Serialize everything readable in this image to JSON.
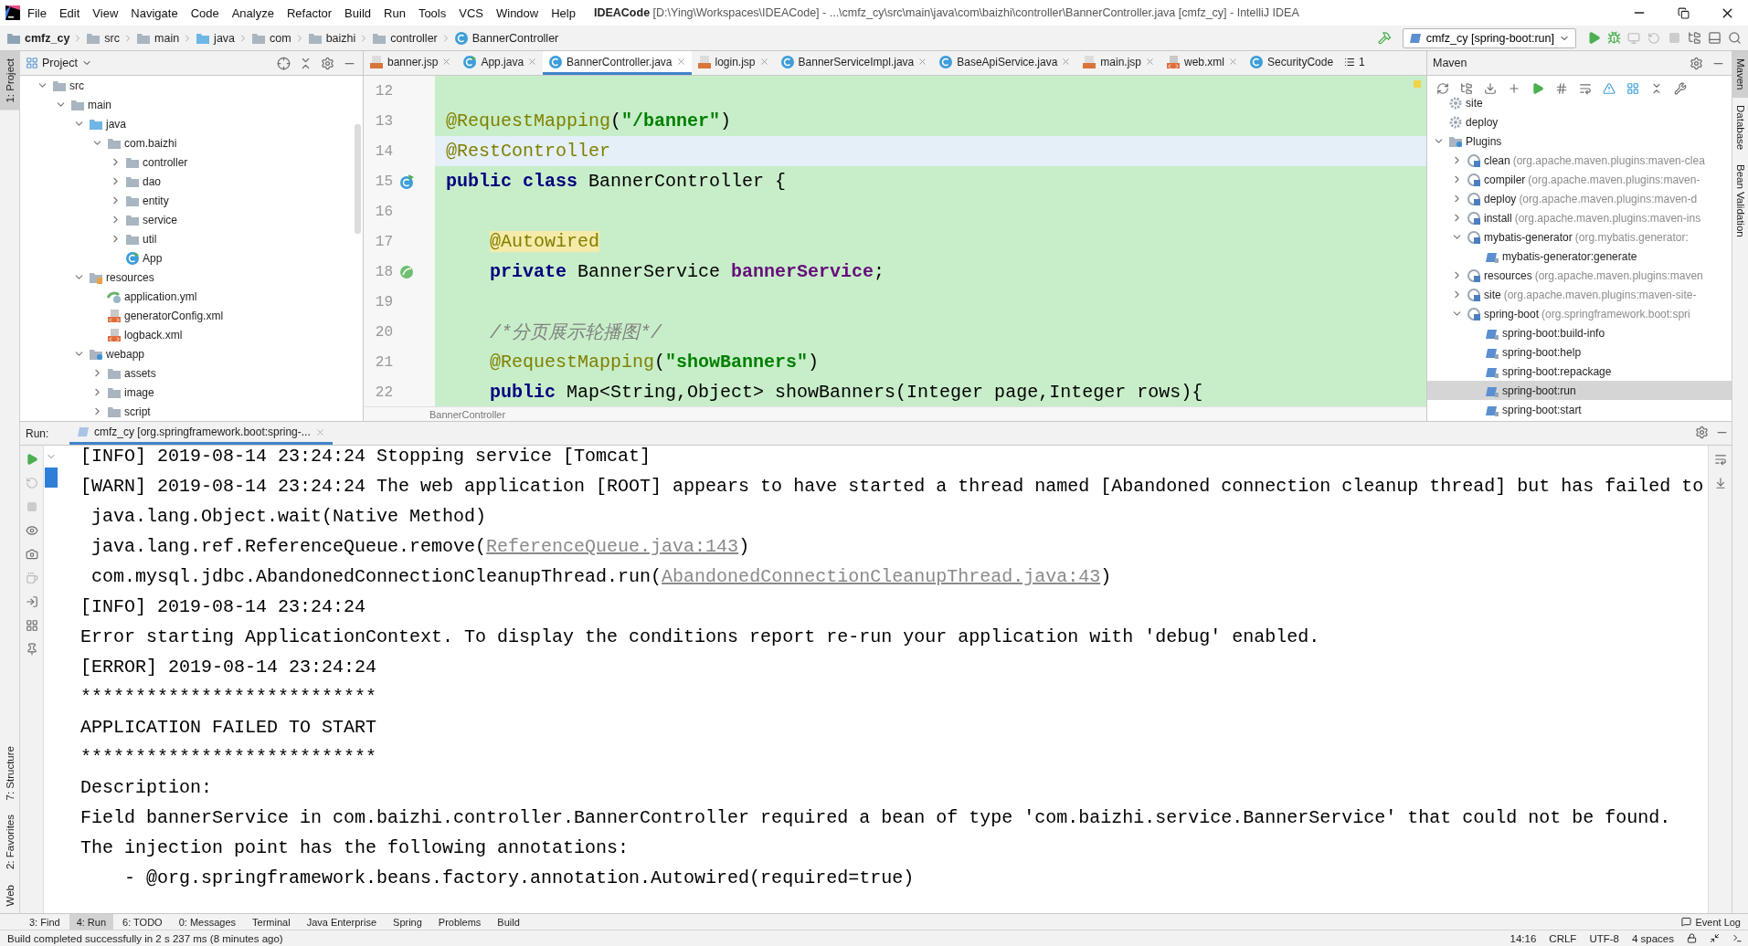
{
  "menu_bar": {
    "items": [
      "File",
      "Edit",
      "View",
      "Navigate",
      "Code",
      "Analyze",
      "Refactor",
      "Build",
      "Run",
      "Tools",
      "VCS",
      "Window",
      "Help"
    ],
    "title": "**IDEACode** [D:\\Ying\\Workspaces\\IDEACode] - ...\\cmfz_cy\\src\\main\\java\\com\\baizhi\\controller\\BannerController.java [cmfz_cy] - IntelliJ IDEA"
  },
  "navigation_bar": {
    "breadcrumbs": [
      {
        "label": "cmfz_cy",
        "kind": "module"
      },
      {
        "label": "src",
        "kind": "folder"
      },
      {
        "label": "main",
        "kind": "folder"
      },
      {
        "label": "java",
        "kind": "source"
      },
      {
        "label": "com",
        "kind": "package"
      },
      {
        "label": "baizhi",
        "kind": "package"
      },
      {
        "label": "controller",
        "kind": "package"
      },
      {
        "label": "BannerController",
        "kind": "class"
      }
    ],
    "run_configuration": "cmfz_cy [spring-boot:run]"
  },
  "left_tool_strip": [
    {
      "label": "1: Project",
      "selected": true
    },
    {
      "label": "7: Structure",
      "selected": false
    },
    {
      "label": "2: Favorites",
      "selected": false
    },
    {
      "label": "Web",
      "selected": false
    }
  ],
  "project_panel": {
    "title": "Project",
    "tree": [
      {
        "label": "src",
        "kind": "folder",
        "expanded": true,
        "children": [
          {
            "label": "main",
            "kind": "folder",
            "expanded": true,
            "children": [
              {
                "label": "java",
                "kind": "source",
                "expanded": true,
                "children": [
                  {
                    "label": "com.baizhi",
                    "kind": "package",
                    "expanded": true,
                    "children": [
                      {
                        "label": "controller",
                        "kind": "package",
                        "expanded": false
                      },
                      {
                        "label": "dao",
                        "kind": "package",
                        "expanded": false
                      },
                      {
                        "label": "entity",
                        "kind": "package",
                        "expanded": false
                      },
                      {
                        "label": "service",
                        "kind": "package",
                        "expanded": false
                      },
                      {
                        "label": "util",
                        "kind": "package",
                        "expanded": false
                      },
                      {
                        "label": "App",
                        "kind": "app"
                      }
                    ]
                  }
                ]
              },
              {
                "label": "resources",
                "kind": "resources",
                "expanded": true,
                "children": [
                  {
                    "label": "application.yml",
                    "kind": "yml"
                  },
                  {
                    "label": "generatorConfig.xml",
                    "kind": "xml"
                  },
                  {
                    "label": "logback.xml",
                    "kind": "xml"
                  }
                ]
              },
              {
                "label": "webapp",
                "kind": "web",
                "expanded": true,
                "children": [
                  {
                    "label": "assets",
                    "kind": "folder",
                    "expanded": false
                  },
                  {
                    "label": "image",
                    "kind": "folder",
                    "expanded": false
                  },
                  {
                    "label": "script",
                    "kind": "folder",
                    "expanded": false
                  }
                ]
              }
            ]
          }
        ]
      }
    ]
  },
  "editor": {
    "tabs": [
      {
        "label": "banner.jsp",
        "kind": "jsp",
        "selected": false,
        "closable": true
      },
      {
        "label": "App.java",
        "kind": "app",
        "selected": false,
        "closable": true
      },
      {
        "label": "BannerController.java",
        "kind": "class",
        "selected": true,
        "closable": true
      },
      {
        "label": "login.jsp",
        "kind": "jsp",
        "selected": false,
        "closable": true
      },
      {
        "label": "BannerServiceImpl.java",
        "kind": "class",
        "selected": false,
        "closable": true
      },
      {
        "label": "BaseApiService.java",
        "kind": "class",
        "selected": false,
        "closable": true
      },
      {
        "label": "main.jsp",
        "kind": "jsp",
        "selected": false,
        "closable": true
      },
      {
        "label": "web.xml",
        "kind": "xml",
        "selected": false,
        "closable": true
      },
      {
        "label": "SecurityCode",
        "kind": "class",
        "selected": false,
        "closable": false
      }
    ],
    "overflow_count": "1",
    "lines": [
      {
        "number": "12",
        "current": false
      },
      {
        "number": "13",
        "current": false,
        "tokens": [
          {
            "text": "@RequestMapping",
            "kind": "annotation"
          },
          {
            "text": "(",
            "kind": "plain"
          },
          {
            "text": "\"/banner\"",
            "kind": "string"
          },
          {
            "text": ")",
            "kind": "plain"
          }
        ]
      },
      {
        "number": "14",
        "current": true,
        "tokens": [
          {
            "text": "@RestController",
            "kind": "annotation"
          }
        ]
      },
      {
        "number": "15",
        "current": false,
        "gutter_icon": {
          "kind": "class"
        },
        "tokens": [
          {
            "text": "public class",
            "kind": "keyword"
          },
          {
            "text": " BannerController {",
            "kind": "plain"
          }
        ]
      },
      {
        "number": "16",
        "current": false
      },
      {
        "number": "17",
        "current": false,
        "tokens": [
          {
            "text": "    @Autowired",
            "kind": "marked"
          }
        ]
      },
      {
        "number": "18",
        "current": false,
        "gutter_icon": {
          "kind": "bean"
        },
        "tokens": [
          {
            "text": "    private",
            "kind": "keyword"
          },
          {
            "text": " BannerService ",
            "kind": "plain"
          },
          {
            "text": "bannerService",
            "kind": "field"
          },
          {
            "text": ";",
            "kind": "plain"
          }
        ]
      },
      {
        "number": "19",
        "current": false
      },
      {
        "number": "20",
        "current": false,
        "tokens": [
          {
            "text": "    /*分页展示轮播图*/",
            "kind": "comment"
          }
        ]
      },
      {
        "number": "21",
        "current": false,
        "tokens": [
          {
            "text": "    @RequestMapping",
            "kind": "annotation"
          },
          {
            "text": "(",
            "kind": "plain"
          },
          {
            "text": "\"showBanners\"",
            "kind": "string"
          },
          {
            "text": ")",
            "kind": "plain"
          }
        ]
      },
      {
        "number": "22",
        "current": false,
        "tokens": [
          {
            "text": "    public",
            "kind": "keyword"
          },
          {
            "text": " Map<String,Object> showBanners(Integer page,Integer rows){",
            "kind": "plain"
          }
        ]
      }
    ],
    "breadcrumb": "BannerController"
  },
  "maven_panel": {
    "title": "Maven",
    "tree": [
      {
        "label": "site",
        "kind": "phase",
        "selected": false
      },
      {
        "label": "deploy",
        "kind": "phase",
        "selected": false
      },
      {
        "label": "Plugins",
        "kind": "plugins",
        "expanded": true,
        "selected": false,
        "children": [
          {
            "label": "clean",
            "detail": "(org.apache.maven.plugins:maven-clea",
            "kind": "plugin",
            "expanded": false,
            "selected": false
          },
          {
            "label": "compiler",
            "detail": "(org.apache.maven.plugins:maven-",
            "kind": "plugin",
            "expanded": false,
            "selected": false
          },
          {
            "label": "deploy",
            "detail": "(org.apache.maven.plugins:maven-d",
            "kind": "plugin",
            "expanded": false,
            "selected": false
          },
          {
            "label": "install",
            "detail": "(org.apache.maven.plugins:maven-ins",
            "kind": "plugin",
            "expanded": false,
            "selected": false
          },
          {
            "label": "mybatis-generator",
            "detail": "(org.mybatis.generator:",
            "kind": "plugin",
            "expanded": true,
            "selected": false,
            "children": [
              {
                "label": "mybatis-generator:generate",
                "kind": "goal",
                "selected": false
              }
            ]
          },
          {
            "label": "resources",
            "detail": "(org.apache.maven.plugins:maven",
            "kind": "plugin",
            "expanded": false,
            "selected": false
          },
          {
            "label": "site",
            "detail": "(org.apache.maven.plugins:maven-site-",
            "kind": "plugin",
            "expanded": false,
            "selected": false
          },
          {
            "label": "spring-boot",
            "detail": "(org.springframework.boot:spri",
            "kind": "plugin",
            "expanded": true,
            "selected": false,
            "children": [
              {
                "label": "spring-boot:build-info",
                "kind": "goal",
                "selected": false
              },
              {
                "label": "spring-boot:help",
                "kind": "goal",
                "selected": false
              },
              {
                "label": "spring-boot:repackage",
                "kind": "goal",
                "selected": false
              },
              {
                "label": "spring-boot:run",
                "kind": "goal",
                "selected": true
              },
              {
                "label": "spring-boot:start",
                "kind": "goal",
                "selected": false
              }
            ]
          }
        ]
      }
    ]
  },
  "right_tool_strip": [
    {
      "label": "Maven",
      "selected": true
    },
    {
      "label": "Database",
      "selected": false
    },
    {
      "label": "Bean Validation",
      "selected": false
    }
  ],
  "run_panel": {
    "label": "Run:",
    "tab": {
      "label": "cmfz_cy [org.springframework.boot:spring-...",
      "selected": true
    },
    "lines": [
      {
        "text": "[INFO] 2019-08-14 23:24:24 Stopping service [Tomcat]"
      },
      {
        "text": "[WARN] 2019-08-14 23:24:24 The web application [ROOT] appears to have started a thread named [Abandoned connection cleanup thread] but has failed to"
      },
      {
        "text": " java.lang.Object.wait(Native Method)"
      },
      {
        "segments": [
          {
            "text": " java.lang.ref.ReferenceQueue.remove(",
            "link": false
          },
          {
            "text": "ReferenceQueue.java:143",
            "link": true
          },
          {
            "text": ")",
            "link": false
          }
        ]
      },
      {
        "segments": [
          {
            "text": " com.mysql.jdbc.AbandonedConnectionCleanupThread.run(",
            "link": false
          },
          {
            "text": "AbandonedConnectionCleanupThread.java:43",
            "link": true
          },
          {
            "text": ")",
            "link": false
          }
        ]
      },
      {
        "text": "[INFO] 2019-08-14 23:24:24"
      },
      {
        "text": "Error starting ApplicationContext. To display the conditions report re-run your application with 'debug' enabled."
      },
      {
        "text": "[ERROR] 2019-08-14 23:24:24"
      },
      {
        "text": "***************************"
      },
      {
        "text": "APPLICATION FAILED TO START"
      },
      {
        "text": "***************************"
      },
      {
        "text": "Description:"
      },
      {
        "text": "Field bannerService in com.baizhi.controller.BannerController required a bean of type 'com.baizhi.service.BannerService' that could not be found."
      },
      {
        "text": "The injection point has the following annotations:"
      },
      {
        "text": "    - @org.springframework.beans.factory.annotation.Autowired(required=true)"
      }
    ]
  },
  "bottom_tool_bar": {
    "items": [
      {
        "label": "3: Find",
        "selected": false
      },
      {
        "label": "4: Run",
        "selected": true
      },
      {
        "label": "6: TODO",
        "selected": false
      },
      {
        "label": "0: Messages",
        "selected": false
      },
      {
        "label": "Terminal",
        "selected": false
      },
      {
        "label": "Java Enterprise",
        "selected": false
      },
      {
        "label": "Spring",
        "selected": false
      },
      {
        "label": "Problems",
        "selected": false
      },
      {
        "label": "Build",
        "selected": false
      }
    ],
    "event_log": "Event Log"
  },
  "status_bar": {
    "message": "Build completed successfully in 2 s 237 ms (8 minutes ago)",
    "items": [
      "14:16",
      "CRLF",
      "UTF-8",
      "4 spaces"
    ]
  }
}
